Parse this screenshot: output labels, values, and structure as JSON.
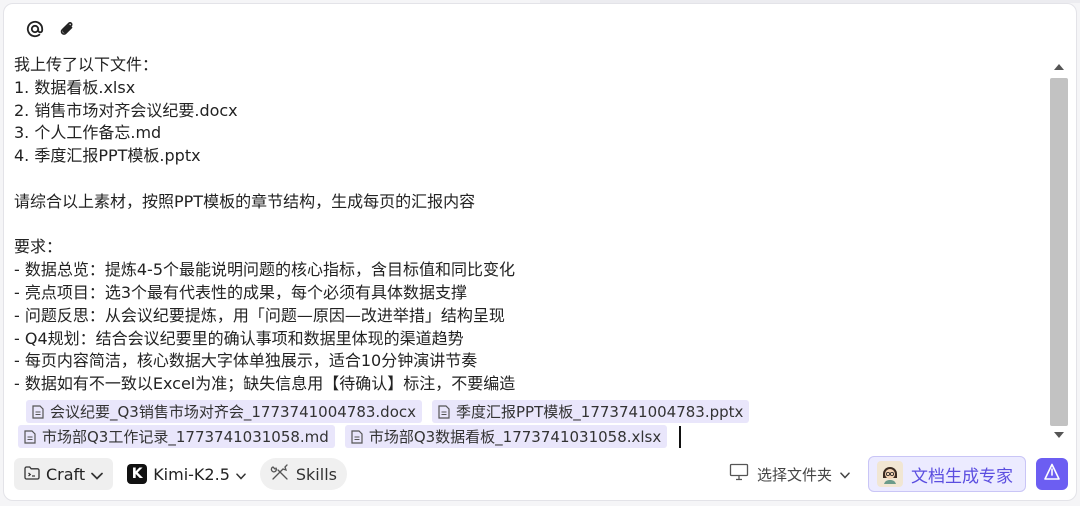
{
  "composer": {
    "lines": [
      "我上传了以下文件：",
      "1. 数据看板.xlsx",
      "2. 销售市场对齐会议纪要.docx",
      "3. 个人工作备忘.md",
      "4. 季度汇报PPT模板.pptx",
      "",
      "请综合以上素材，按照PPT模板的章节结构，生成每页的汇报内容",
      "",
      "要求：",
      "- 数据总览：提炼4-5个最能说明问题的核心指标，含目标值和同比变化",
      "- 亮点项目：选3个最有代表性的成果，每个必须有具体数据支撑",
      "- 问题反思：从会议纪要提炼，用「问题—原因—改进举措」结构呈现",
      "- Q4规划：结合会议纪要里的确认事项和数据里体现的渠道趋势",
      "- 每页内容简洁，核心数据大字体单独展示，适合10分钟演讲节奏",
      "- 数据如有不一致以Excel为准；缺失信息用【待确认】标注，不要编造"
    ],
    "attachments_row1": [
      "会议纪要_Q3销售市场对齐会_1773741004783.docx",
      "季度汇报PPT模板_1773741004783.pptx"
    ],
    "attachments_row2": [
      "市场部Q3工作记录_1773741031058.md",
      "市场部Q3数据看板_1773741031058.xlsx"
    ]
  },
  "toolbar": {
    "mode_label": "Craft",
    "model_label": "Kimi-K2.5",
    "model_logo": "K",
    "skills_label": "Skills",
    "folder_label": "选择文件夹",
    "expert_label": "文档生成专家"
  },
  "icons": {
    "mention": "at-icon",
    "attach": "paperclip-icon",
    "send": "send-icon"
  },
  "colors": {
    "accent": "#6c5ef2",
    "chip_bg": "#e9e6fb",
    "expert_bg": "#ecebff"
  }
}
